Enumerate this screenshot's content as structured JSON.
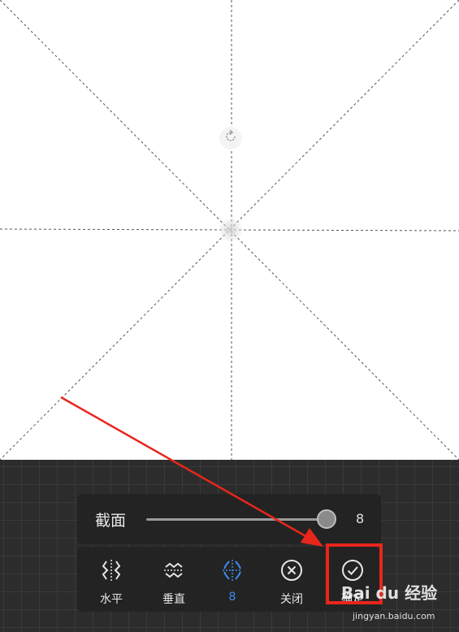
{
  "section_panel": {
    "label": "截面",
    "slider_value": "8",
    "slider_level": 0.95
  },
  "tools": [
    {
      "id": "horizontal",
      "label": "水平",
      "icon": "mirror-horizontal-icon",
      "active": false
    },
    {
      "id": "vertical",
      "label": "垂直",
      "icon": "mirror-vertical-icon",
      "active": false
    },
    {
      "id": "sections",
      "label": "8",
      "icon": "section-split-icon",
      "active": true
    },
    {
      "id": "close",
      "label": "关闭",
      "icon": "close-circle-icon",
      "active": false
    },
    {
      "id": "confirm",
      "label": "确定",
      "icon": "check-circle-icon",
      "active": false
    }
  ],
  "annotation": {
    "arrow_color": "#e8261c",
    "box_color": "#e8261c"
  },
  "watermark": {
    "brand": "Bai du 经验",
    "url": "jingyan.baidu.com"
  },
  "colors": {
    "accent": "#3d8cf0",
    "panel": "#232323",
    "canvas": "#ffffff"
  }
}
